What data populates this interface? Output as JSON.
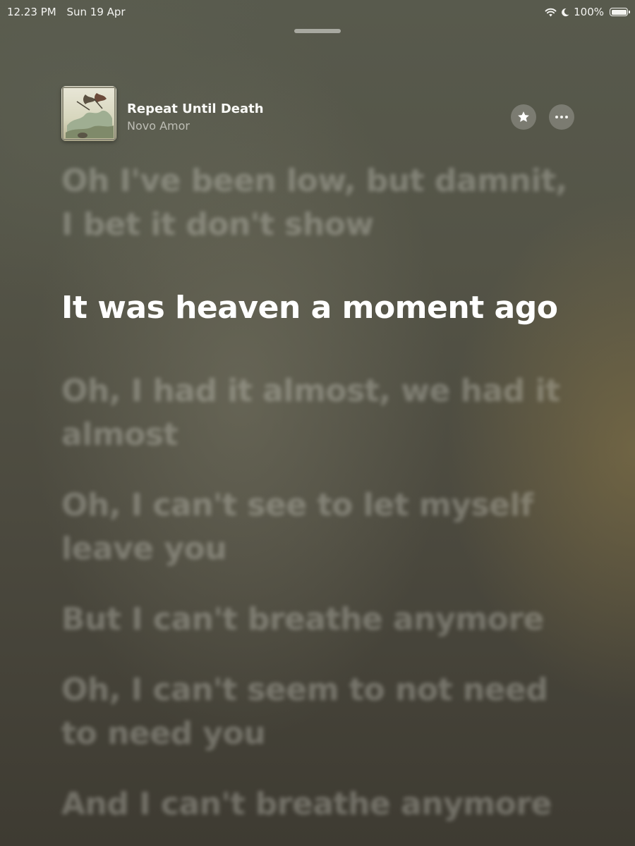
{
  "status_bar": {
    "time": "12.23 PM",
    "date": "Sun 19 Apr",
    "battery": "100%",
    "icons": [
      "wifi-icon",
      "moon-icon",
      "battery-icon"
    ]
  },
  "now_playing": {
    "title": "Repeat Until Death",
    "artist": "Novo Amor",
    "actions": [
      "star-icon",
      "more-icon"
    ]
  },
  "lyrics": {
    "lines": [
      "Oh I've been low, but damnit, I bet it don't show",
      "It was heaven a moment ago",
      "Oh, I had it almost, we had it almost",
      "Oh, I can't see to let myself leave you",
      "But I can't breathe anymore",
      "Oh, I can't seem to not need to need you",
      "And I can't breathe anymore"
    ],
    "current_index": 1
  },
  "colors": {
    "accent": "#ffffff",
    "dim_lyric": "#e1e1d7"
  }
}
